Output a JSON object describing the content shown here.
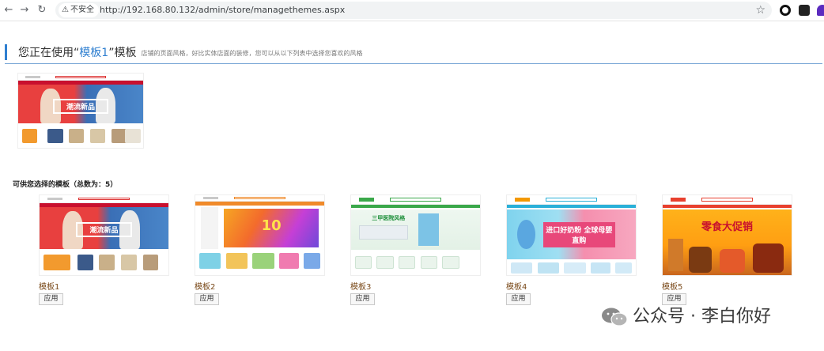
{
  "browser": {
    "security_label": "不安全",
    "url": "http://192.168.80.132/admin/store/managethemes.aspx"
  },
  "current": {
    "prefix": "您正在使用“",
    "theme_name": "模板1",
    "suffix": "”模板",
    "description": "店铺的页面风格，好比实体店面的装修，您可以从以下列表中选择您喜欢的风格",
    "preview_slogan": "潮流新品"
  },
  "available": {
    "title": "可供您选择的模板（总数为：5）",
    "themes": [
      {
        "name": "模板1",
        "apply_label": "应用",
        "slogan": "潮流新品"
      },
      {
        "name": "模板2",
        "apply_label": "应用",
        "slogan": "10"
      },
      {
        "name": "模板3",
        "apply_label": "应用",
        "slogan": "三甲医院风格"
      },
      {
        "name": "模板4",
        "apply_label": "应用",
        "slogan": "进口好奶粉 全球母婴直购"
      },
      {
        "name": "模板5",
        "apply_label": "应用",
        "slogan": "零食大促销"
      }
    ]
  },
  "watermark": {
    "text": "公众号 · 李白你好"
  },
  "colors": {
    "accent_blue": "#2f7fd0",
    "theme_name_brown": "#7a4a1a"
  }
}
